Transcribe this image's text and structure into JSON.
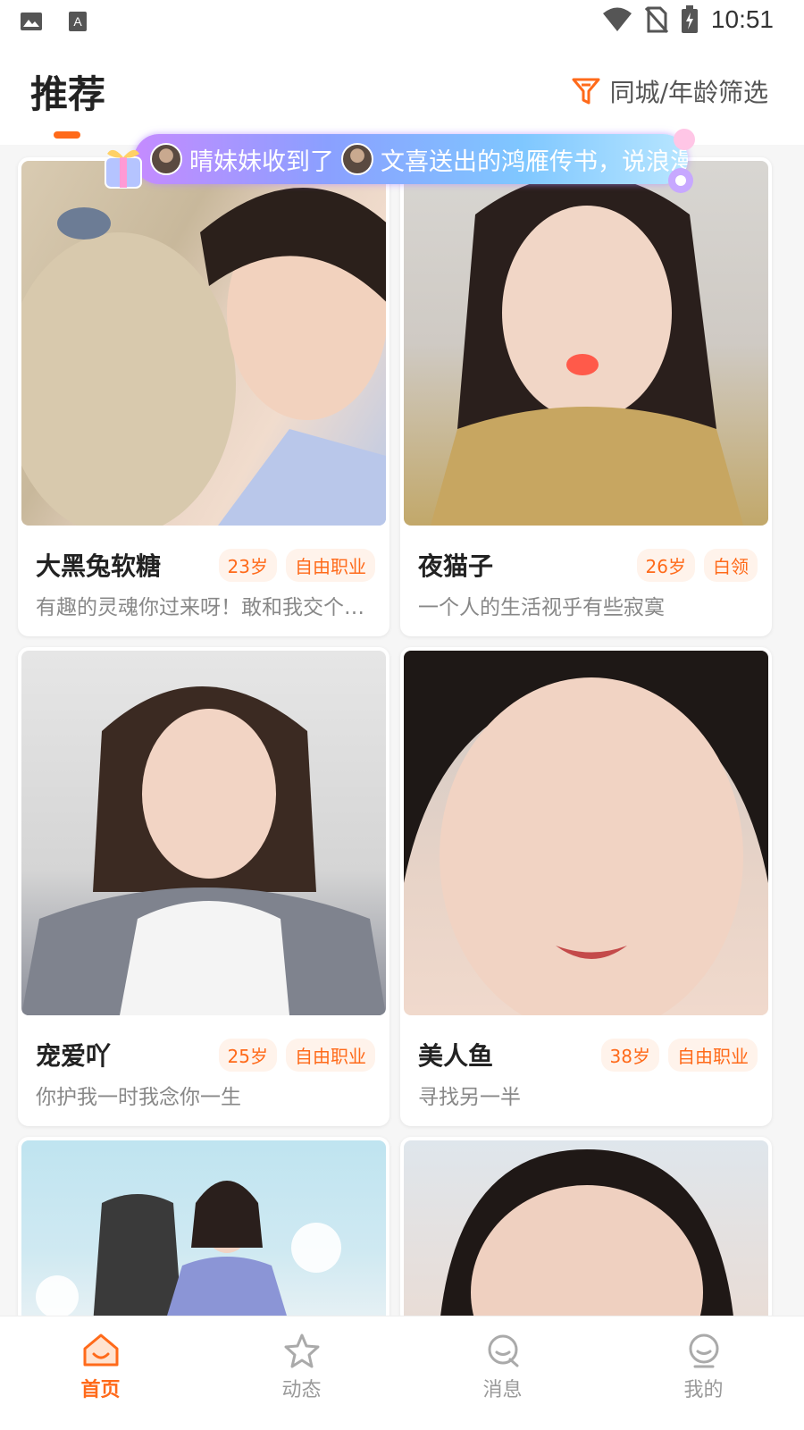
{
  "status_bar": {
    "time": "10:51"
  },
  "header": {
    "title": "推荐",
    "filter_label": "同城/年龄筛选"
  },
  "banner": {
    "text_part1": "晴妹妹收到了",
    "text_part2": "文喜送出的鸿雁传书，说浪漫到"
  },
  "cards": [
    {
      "name": "大黑兔软糖",
      "age": "23岁",
      "job": "自由职业",
      "bio": "有趣的灵魂你过来呀！敢和我交个朋友吗"
    },
    {
      "name": "夜猫子",
      "age": "26岁",
      "job": "白领",
      "bio": "一个人的生活视乎有些寂寞"
    },
    {
      "name": "宠爱吖",
      "age": "25岁",
      "job": "自由职业",
      "bio": "你护我一时我念你一生"
    },
    {
      "name": "美人鱼",
      "age": "38岁",
      "job": "自由职业",
      "bio": "寻找另一半"
    },
    {
      "name": "",
      "age": "",
      "job": "",
      "bio": ""
    },
    {
      "name": "",
      "age": "",
      "job": "",
      "bio": ""
    }
  ],
  "nav": [
    {
      "label": "首页",
      "icon": "home-icon",
      "active": true
    },
    {
      "label": "动态",
      "icon": "star-icon",
      "active": false
    },
    {
      "label": "消息",
      "icon": "message-icon",
      "active": false
    },
    {
      "label": "我的",
      "icon": "profile-icon",
      "active": false
    }
  ],
  "colors": {
    "accent": "#ff6a1a",
    "tag_bg": "#fff3eb"
  }
}
